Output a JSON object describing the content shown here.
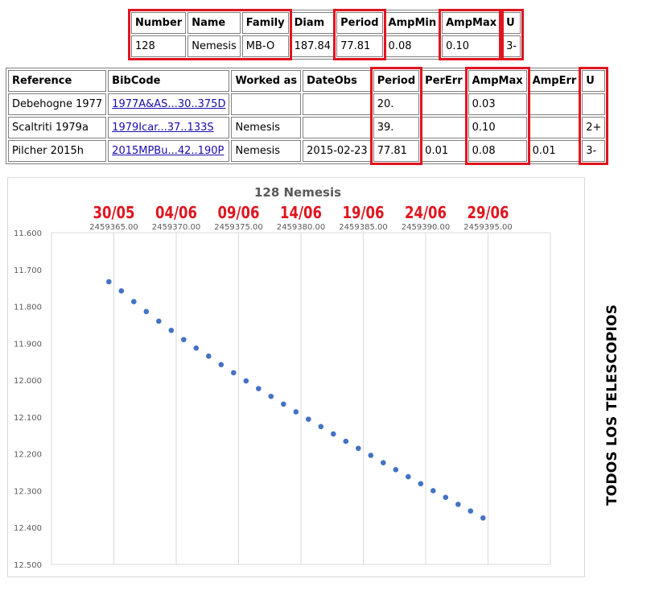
{
  "top_table": {
    "headers": [
      "Number",
      "Name",
      "Family",
      "Diam",
      "Period",
      "AmpMin",
      "AmpMax",
      "U"
    ],
    "row": [
      "128",
      "Nemesis",
      "MB-O",
      "187.84",
      "77.81",
      "0.08",
      "0.10",
      "3-"
    ]
  },
  "ref_table": {
    "headers": [
      "Reference",
      "BibCode",
      "Worked as",
      "DateObs",
      "Period",
      "PerErr",
      "AmpMax",
      "AmpErr",
      "U"
    ],
    "rows": [
      [
        "Debehogne 1977",
        "1977A&AS...30..375D",
        "",
        "",
        "20.",
        "",
        "0.03",
        "",
        ""
      ],
      [
        "Scaltriti 1979a",
        "1979Icar...37..133S",
        "Nemesis",
        "",
        "39.",
        "",
        "0.10",
        "",
        "2+"
      ],
      [
        "Pilcher 2015h",
        "2015MPBu...42..190P",
        "Nemesis",
        "2015-02-23",
        "77.81",
        "0.01",
        "0.08",
        "0.01",
        "3-"
      ]
    ]
  },
  "colors": {
    "highlight": "#e0151f",
    "marker": "#4472c4",
    "gridline": "#d9d9d9"
  },
  "side_label": "TODOS LOS TELESCOPIOS",
  "chart_data": {
    "type": "scatter",
    "title": "128 Nemesis",
    "x_ticks": [
      2459365.0,
      2459370.0,
      2459375.0,
      2459380.0,
      2459385.0,
      2459390.0,
      2459395.0
    ],
    "x_tick_labels": [
      "2459365.00",
      "2459370.00",
      "2459375.00",
      "2459380.00",
      "2459385.00",
      "2459390.00",
      "2459395.00"
    ],
    "date_annotations": [
      "30/05",
      "04/06",
      "09/06",
      "14/06",
      "19/06",
      "24/06",
      "29/06"
    ],
    "xlim": [
      2459360.0,
      2459400.0
    ],
    "y_ticks": [
      11.6,
      11.7,
      11.8,
      11.9,
      12.0,
      12.1,
      12.2,
      12.3,
      12.4,
      12.5
    ],
    "y_tick_labels": [
      "11.600",
      "11.700",
      "11.800",
      "11.900",
      "12.000",
      "12.100",
      "12.200",
      "12.300",
      "12.400",
      "12.500"
    ],
    "ylim": [
      11.6,
      12.5
    ],
    "y_inverted": true,
    "grid": "vertical",
    "series": [
      {
        "x": [
          2459364.6,
          2459365.6,
          2459366.6,
          2459367.6,
          2459368.6,
          2459369.6,
          2459370.6,
          2459371.6,
          2459372.6,
          2459373.6,
          2459374.6,
          2459375.6,
          2459376.6,
          2459377.6,
          2459378.6,
          2459379.6,
          2459380.6,
          2459381.6,
          2459382.6,
          2459383.6,
          2459384.6,
          2459385.6,
          2459386.6,
          2459387.6,
          2459388.6,
          2459389.6,
          2459390.6,
          2459391.6,
          2459392.6,
          2459393.6,
          2459394.6
        ],
        "y": [
          11.733,
          11.758,
          11.787,
          11.814,
          11.84,
          11.865,
          11.89,
          11.913,
          11.935,
          11.958,
          11.98,
          12.002,
          12.023,
          12.044,
          12.065,
          12.086,
          12.106,
          12.126,
          12.146,
          12.166,
          12.185,
          12.204,
          12.224,
          12.243,
          12.262,
          12.281,
          12.3,
          12.318,
          12.337,
          12.355,
          12.374
        ]
      }
    ]
  }
}
